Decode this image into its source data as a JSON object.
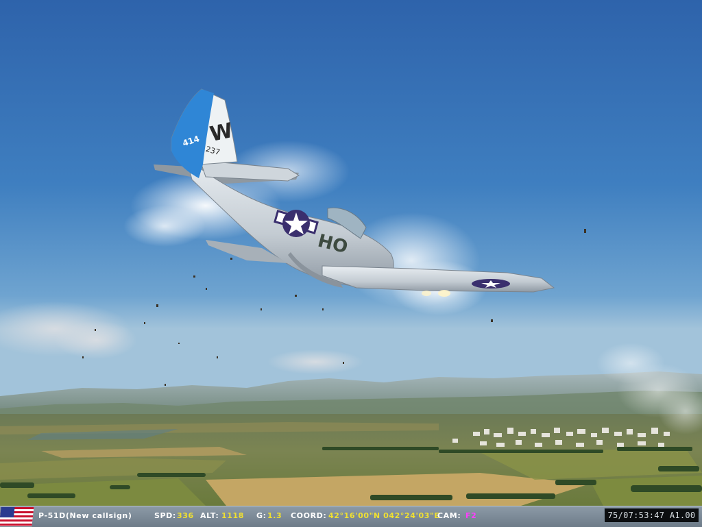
{
  "hud": {
    "aircraft": "P-51D(New callsign)",
    "speed_label": "SPD:",
    "speed_value": "336",
    "altitude_label": "ALT:",
    "altitude_value": "1118",
    "g_label": "G:",
    "g_value": "1.3",
    "coord_label": "COORD:",
    "coord_value": "42°16'00\"N 042°24'03\"E",
    "cam_label": "CAM:",
    "cam_value": "F2",
    "time_display": "75/07:53:47 A1.00",
    "flag": "usa-flag-icon"
  },
  "aircraft_markings": {
    "tail_letter": "W",
    "tail_serial_left": "414",
    "tail_serial_right": "237",
    "fuselage_code": "HO"
  },
  "colors": {
    "sky_top": "#2f65ad",
    "sky_horizon": "#9bbdd6",
    "tail_blue": "#2f86d6",
    "label_yellow": "#f0e030",
    "cam_magenta": "#ff3cff"
  }
}
